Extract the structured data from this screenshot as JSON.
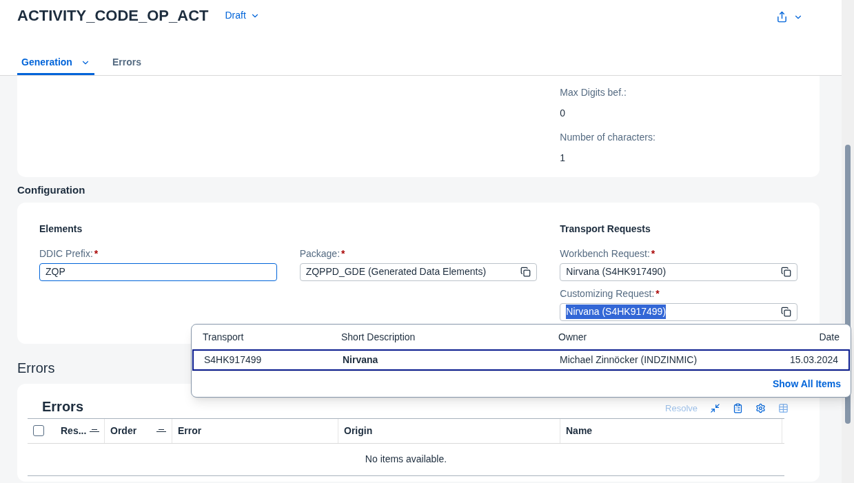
{
  "header": {
    "title": "ACTIVITY_CODE_OP_ACT",
    "status": "Draft"
  },
  "tabs": [
    {
      "label": "Generation",
      "selected": true,
      "has_menu": true
    },
    {
      "label": "Errors",
      "selected": false,
      "has_menu": false
    }
  ],
  "limits": [
    {
      "label": "Max Digits bef.:",
      "value": "0"
    },
    {
      "label": "Number of characters:",
      "value": "1"
    }
  ],
  "configuration": {
    "title": "Configuration",
    "groups": [
      {
        "title": "Elements",
        "fields": [
          {
            "label": "DDIC Prefix:",
            "required": "*",
            "value": "ZQP",
            "kind": "input",
            "focused": true,
            "text_selected": false
          }
        ]
      },
      {
        "fields": [
          {
            "label": "Package:",
            "required": "*",
            "value": "ZQPPD_GDE (Generated Data Elements)",
            "kind": "value_help",
            "focused": false,
            "text_selected": false
          }
        ]
      },
      {
        "title": "Transport Requests",
        "fields": [
          {
            "label": "Workbench Request:",
            "required": "*",
            "value": "Nirvana (S4HK917490)",
            "kind": "value_help",
            "focused": false,
            "text_selected": false
          },
          {
            "label": "Customizing Request:",
            "required": "*",
            "value": "Nirvana (S4HK917499)",
            "kind": "value_help",
            "focused": false,
            "text_selected": true
          }
        ]
      }
    ]
  },
  "suggestions": {
    "columns": [
      "Transport",
      "Short Description",
      "Owner",
      "Date"
    ],
    "rows": [
      {
        "cells": [
          "S4HK917499",
          "Nirvana",
          "Michael Zinnöcker (INDZINMIC)",
          "15.03.2024"
        ],
        "selected": true
      }
    ],
    "footer_link": "Show All Items"
  },
  "errors": {
    "section_title": "Errors",
    "table_title": "Errors",
    "toolbar": [
      {
        "label": "Resolve",
        "disabled": true
      }
    ],
    "select_all": {
      "checked": false
    },
    "columns": [
      {
        "label": "Res...",
        "sortable": true
      },
      {
        "label": "Order",
        "sortable": true
      },
      {
        "label": "Error",
        "sortable": false
      },
      {
        "label": "Origin",
        "sortable": false
      },
      {
        "label": "Name",
        "sortable": false
      }
    ],
    "empty_text": "No items available."
  }
}
